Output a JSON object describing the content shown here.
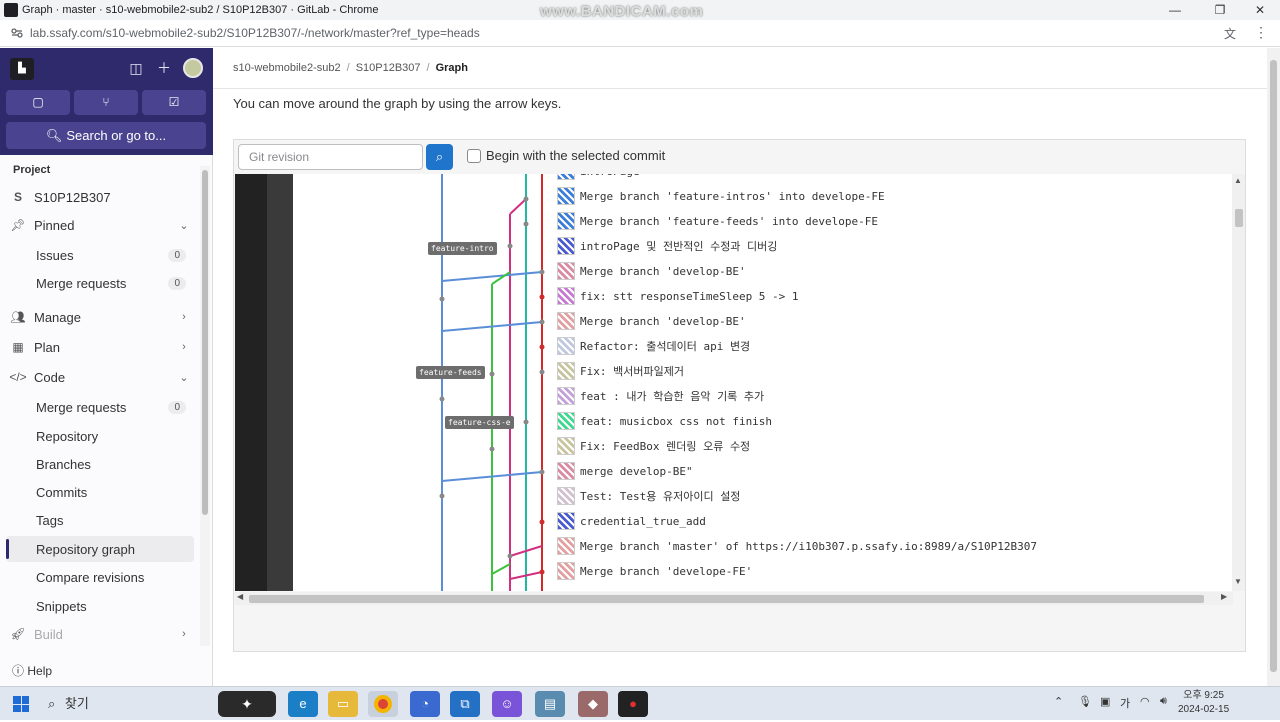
{
  "window": {
    "title": "Graph · master · s10-webmobile2-sub2 / S10P12B307 · GitLab - Chrome",
    "watermark": "www.BANDICAM.com",
    "url": "lab.ssafy.com/s10-webmobile2-sub2/S10P12B307/-/network/master?ref_type=heads"
  },
  "sidebar": {
    "search_label": "Search or go to...",
    "section": "Project",
    "project_initial": "S",
    "project_name": "S10P12B307",
    "pinned": "Pinned",
    "pinned_items": [
      {
        "label": "Issues",
        "count": "0"
      },
      {
        "label": "Merge requests",
        "count": "0"
      }
    ],
    "manage": "Manage",
    "plan": "Plan",
    "code": "Code",
    "code_items": [
      {
        "label": "Merge requests",
        "count": "0"
      },
      {
        "label": "Repository"
      },
      {
        "label": "Branches"
      },
      {
        "label": "Commits"
      },
      {
        "label": "Tags"
      },
      {
        "label": "Repository graph"
      },
      {
        "label": "Compare revisions"
      },
      {
        "label": "Snippets"
      }
    ],
    "build": "Build",
    "help": "Help"
  },
  "breadcrumb": {
    "group": "s10-webmobile2-sub2",
    "project": "S10P12B307",
    "current": "Graph"
  },
  "hint": "You can move around the graph by using the arrow keys.",
  "filter": {
    "placeholder": "Git revision",
    "checkbox_label": "Begin with the selected commit"
  },
  "graph": {
    "commits": [
      {
        "message": "introPage",
        "avatar_color": "#3d7fd8"
      },
      {
        "message": "Merge branch 'feature-intros' into develope-FE",
        "avatar_color": "#3d7fd8"
      },
      {
        "message": "Merge branch 'feature-feeds' into develope-FE",
        "avatar_color": "#3d7fd8"
      },
      {
        "message": "introPage 및 전반적인 수정과 디버깅",
        "avatar_color": "#4a5bd0"
      },
      {
        "message": "Merge branch 'develop-BE'",
        "avatar_color": "#d98ca0"
      },
      {
        "message": "fix: stt responseTimeSleep 5 -> 1",
        "avatar_color": "#c47bd0"
      },
      {
        "message": "Merge branch 'develop-BE'",
        "avatar_color": "#e3a0a0"
      },
      {
        "message": "Refactor: 출석데이터 api 변경",
        "avatar_color": "#c0c8e0"
      },
      {
        "message": "Fix: 백서버파일제거",
        "avatar_color": "#c9c4a0"
      },
      {
        "message": "feat : 내가 학습한 음악 기록 추가",
        "avatar_color": "#c4a0d8"
      },
      {
        "message": "feat: musicbox css not finish",
        "avatar_color": "#40d890"
      },
      {
        "message": "Fix: FeedBox 렌더링 오류 수정",
        "avatar_color": "#c9c4a0"
      },
      {
        "message": "merge develop-BE\"",
        "avatar_color": "#d98ca0"
      },
      {
        "message": "Test: Test용 유저아이디 설정",
        "avatar_color": "#d0c0d0"
      },
      {
        "message": "credential_true_add",
        "avatar_color": "#4a5bd0"
      },
      {
        "message": "Merge branch 'master' of https://i10b307.p.ssafy.io:8989/a/S10P12B307",
        "avatar_color": "#e3a0a0"
      },
      {
        "message": "Merge branch 'develope-FE'",
        "avatar_color": "#e3a0a0"
      }
    ],
    "tags": [
      "feature-intro",
      "feature-feeds",
      "feature-css-e"
    ]
  },
  "taskbar": {
    "search": "찾기",
    "time_period": "오후 9:25",
    "date": "2024-02-15"
  }
}
